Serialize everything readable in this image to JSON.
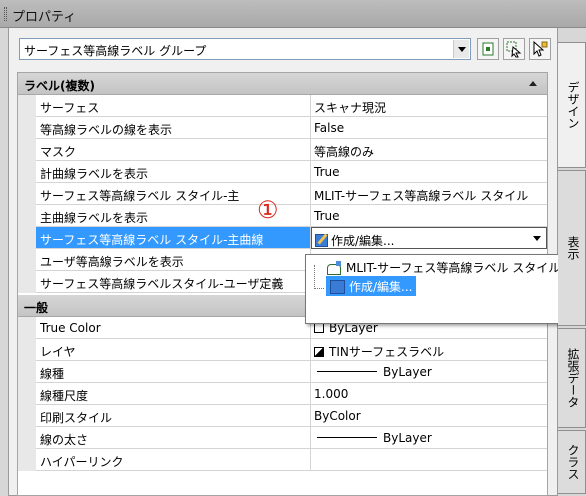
{
  "window": {
    "title": "プロパティ"
  },
  "selector": {
    "value": "サーフェス等高線ラベル グループ"
  },
  "categories": {
    "label": "ラベル(複数)",
    "general": "一般"
  },
  "label_rows": [
    {
      "name": "サーフェス",
      "value": "スキャナ現況"
    },
    {
      "name": "等高線ラベルの線を表示",
      "value": "False"
    },
    {
      "name": "マスク",
      "value": "等高線のみ"
    },
    {
      "name": "計曲線ラベルを表示",
      "value": "True"
    },
    {
      "name": "サーフェス等高線ラベル スタイル-主",
      "value": "MLIT-サーフェス等高線ラベル スタイル"
    },
    {
      "name": "主曲線ラベルを表示",
      "value": "True"
    },
    {
      "name": "サーフェス等高線ラベル スタイル-主曲線",
      "value": "作成/編集..."
    },
    {
      "name": "ユーザ等高線ラベルを表示",
      "value": ""
    },
    {
      "name": "サーフェス等高線ラベルスタイル-ユーザ定義",
      "value": ""
    }
  ],
  "general_rows": [
    {
      "name": "True Color",
      "value": "ByLayer"
    },
    {
      "name": "レイヤ",
      "value": "TINサーフェスラベル"
    },
    {
      "name": "線種",
      "value": "ByLayer"
    },
    {
      "name": "線種尺度",
      "value": "1.000"
    },
    {
      "name": "印刷スタイル",
      "value": "ByColor"
    },
    {
      "name": "線の太さ",
      "value": "ByLayer"
    },
    {
      "name": "ハイパーリンク",
      "value": ""
    }
  ],
  "annotation": "①",
  "dropdown_options": [
    "MLIT-サーフェス等高線ラベル スタイル",
    "作成/編集..."
  ],
  "side_tabs": [
    "デザイン",
    "表示",
    "拡張データ",
    "クラス"
  ],
  "colors": {
    "selection": "#3399ff",
    "annotation": "#d8261c"
  }
}
